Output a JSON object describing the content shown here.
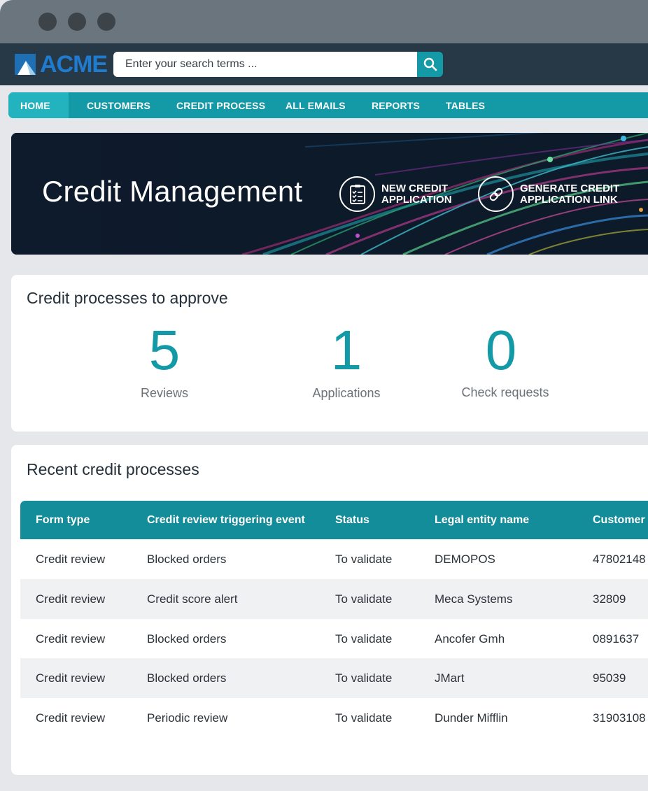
{
  "window": {
    "controls": [
      "close",
      "minimize",
      "maximize"
    ]
  },
  "header": {
    "logo_text": "ACME",
    "search_placeholder": "Enter your search terms ...",
    "search_icon": "search-icon"
  },
  "nav": {
    "items": [
      {
        "label": "HOME",
        "active": true
      },
      {
        "label": "CUSTOMERS",
        "active": false
      },
      {
        "label": "CREDIT PROCESS",
        "active": false
      },
      {
        "label": "ALL EMAILS",
        "active": false
      },
      {
        "label": "REPORTS",
        "active": false
      },
      {
        "label": "TABLES",
        "active": false
      }
    ]
  },
  "hero": {
    "title": "Credit Management",
    "actions": [
      {
        "label": "NEW CREDIT APPLICATION",
        "icon": "checklist-icon"
      },
      {
        "label": "GENERATE CREDIT APPLICATION LINK",
        "icon": "link-icon"
      }
    ]
  },
  "approve": {
    "title": "Credit processes to approve",
    "stats": [
      {
        "value": "5",
        "label": "Reviews"
      },
      {
        "value": "1",
        "label": "Applications"
      },
      {
        "value": "0",
        "label": "Check requests"
      }
    ]
  },
  "recent": {
    "title": "Recent credit processes",
    "columns": [
      "Form type",
      "Credit review triggering event",
      "Status",
      "Legal entity name",
      "Customer"
    ],
    "rows": [
      [
        "Credit review",
        "Blocked orders",
        "To validate",
        "DEMOPOS",
        "47802148"
      ],
      [
        "Credit review",
        "Credit score alert",
        "To validate",
        "Meca Systems",
        "32809"
      ],
      [
        "Credit review",
        "Blocked orders",
        "To validate",
        "Ancofer Gmh",
        "0891637"
      ],
      [
        "Credit review",
        "Blocked orders",
        "To validate",
        "JMart",
        "95039"
      ],
      [
        "Credit review",
        "Periodic review",
        "To validate",
        "Dunder Mifflin",
        "31903108"
      ]
    ]
  },
  "colors": {
    "accent": "#149aa7",
    "header_bg": "#273946",
    "table_head": "#128d99",
    "hero_bg": "#0e1b2c"
  }
}
